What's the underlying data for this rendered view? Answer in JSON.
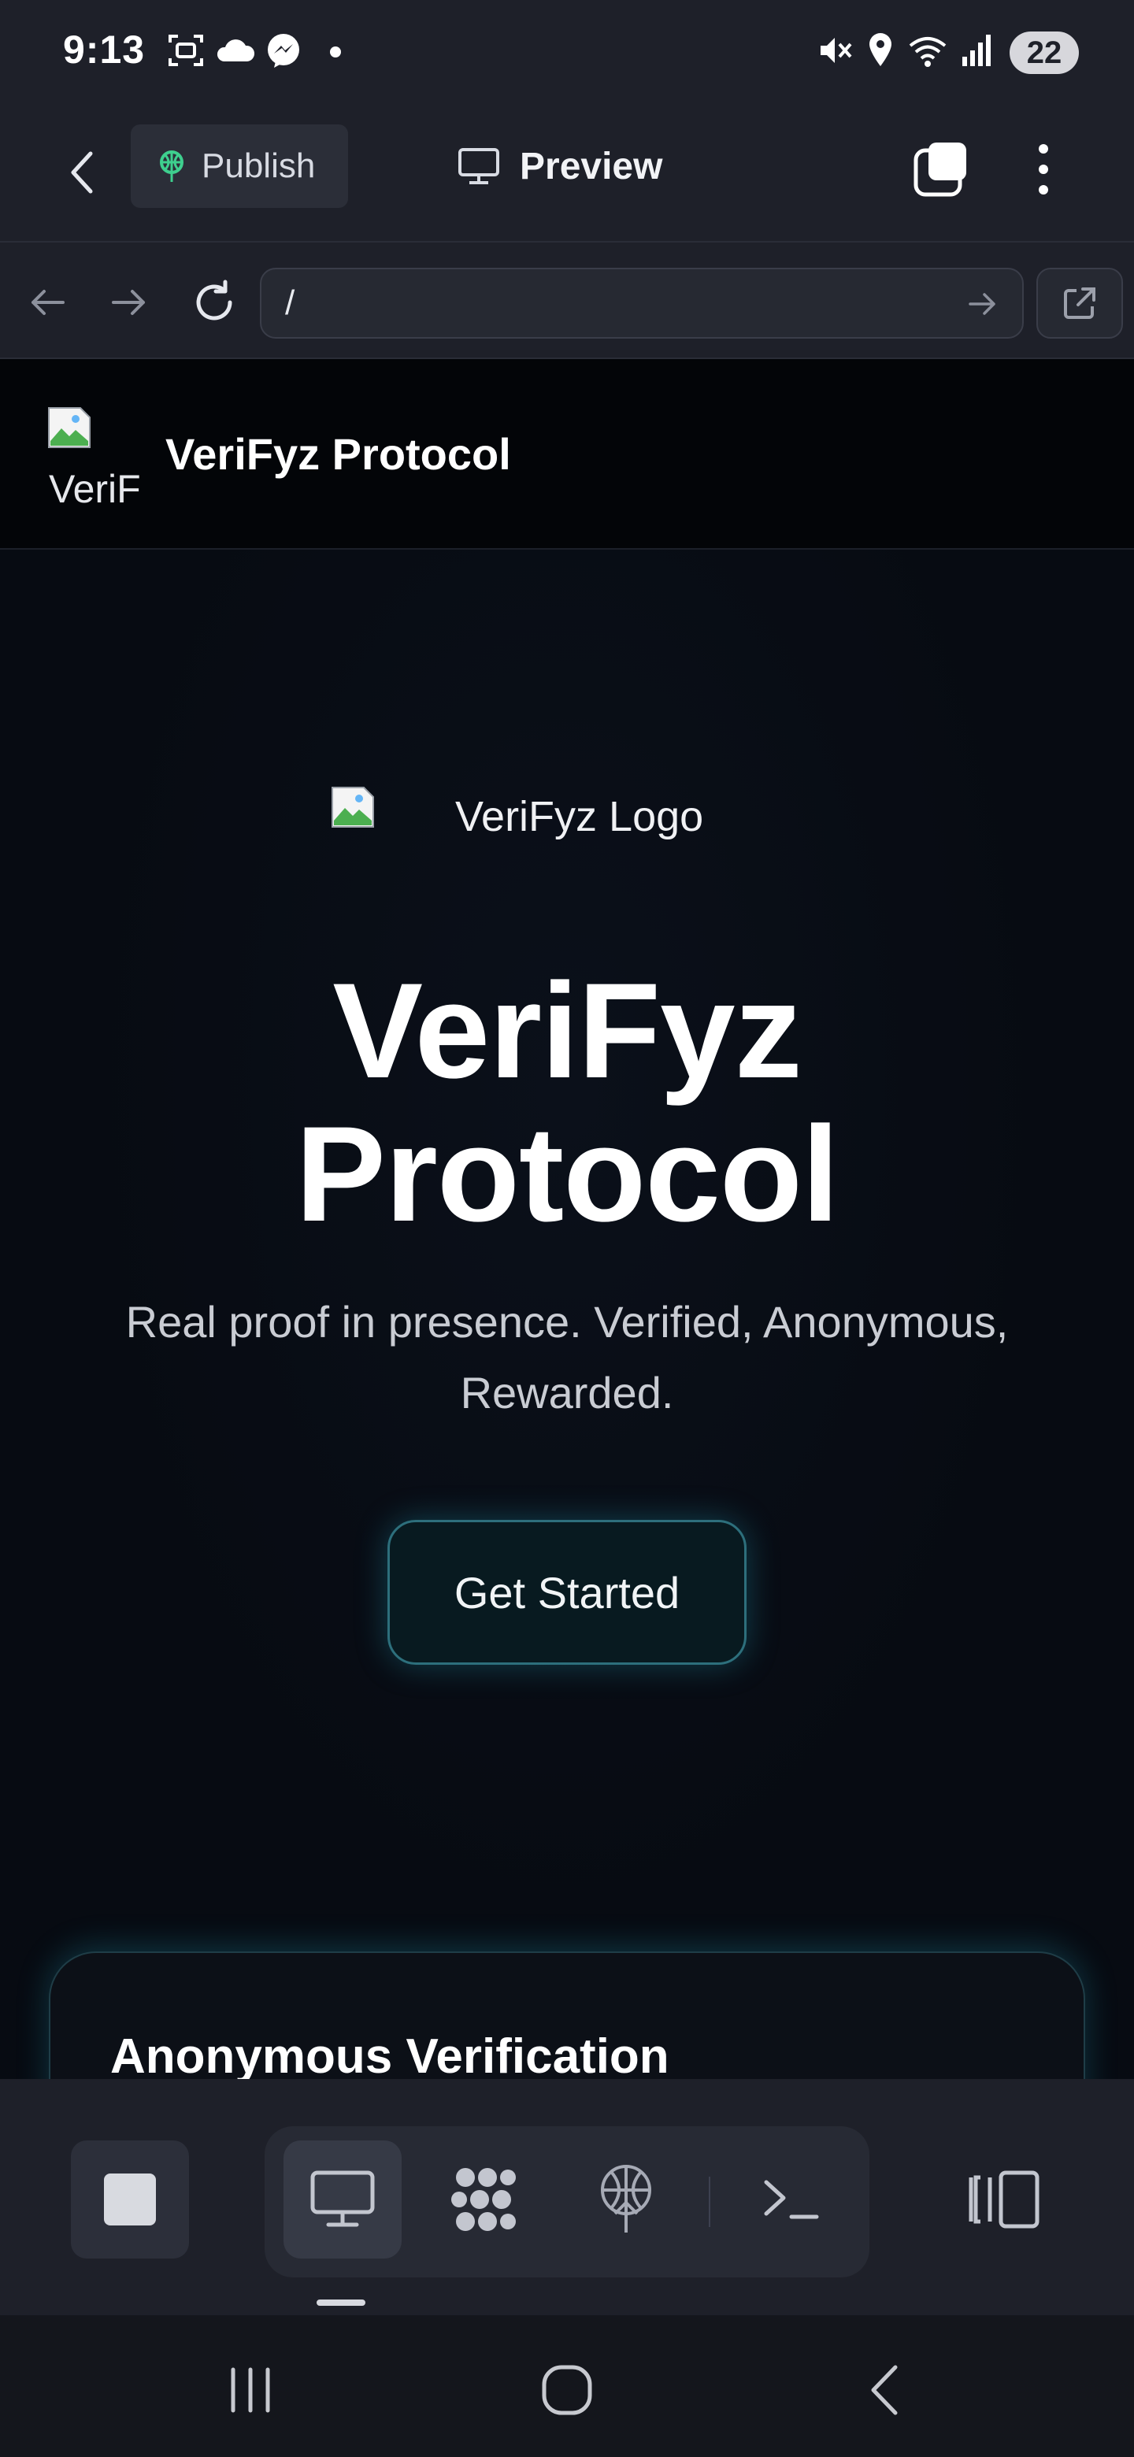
{
  "status_bar": {
    "time": "9:13",
    "battery": "22",
    "icons": [
      "screenshot-icon",
      "cloud-icon",
      "messenger-icon",
      "dot-icon",
      "mute-icon",
      "location-icon",
      "wifi-icon",
      "signal-icon"
    ]
  },
  "toolbar": {
    "publish_label": "Publish",
    "preview_label": "Preview"
  },
  "url_bar": {
    "value": "/"
  },
  "site": {
    "header_logo_alt": "VeriF",
    "header_title": "VeriFyz Protocol",
    "hero_logo_alt": "VeriFyz Logo",
    "hero_title_line1": "VeriFyz",
    "hero_title_line2": "Protocol",
    "hero_sub_line1": "Real proof in presence. Verified, Anonymous,",
    "hero_sub_line2": "Rewarded.",
    "cta_label": "Get Started",
    "feature_title": "Anonymous Verification"
  },
  "dock": {
    "items": [
      "desktop-icon",
      "grid-icon",
      "deploy-icon",
      "terminal-icon"
    ]
  },
  "colors": {
    "accent_glow": "#23a0b9",
    "publish_icon": "#3ecf8e"
  }
}
